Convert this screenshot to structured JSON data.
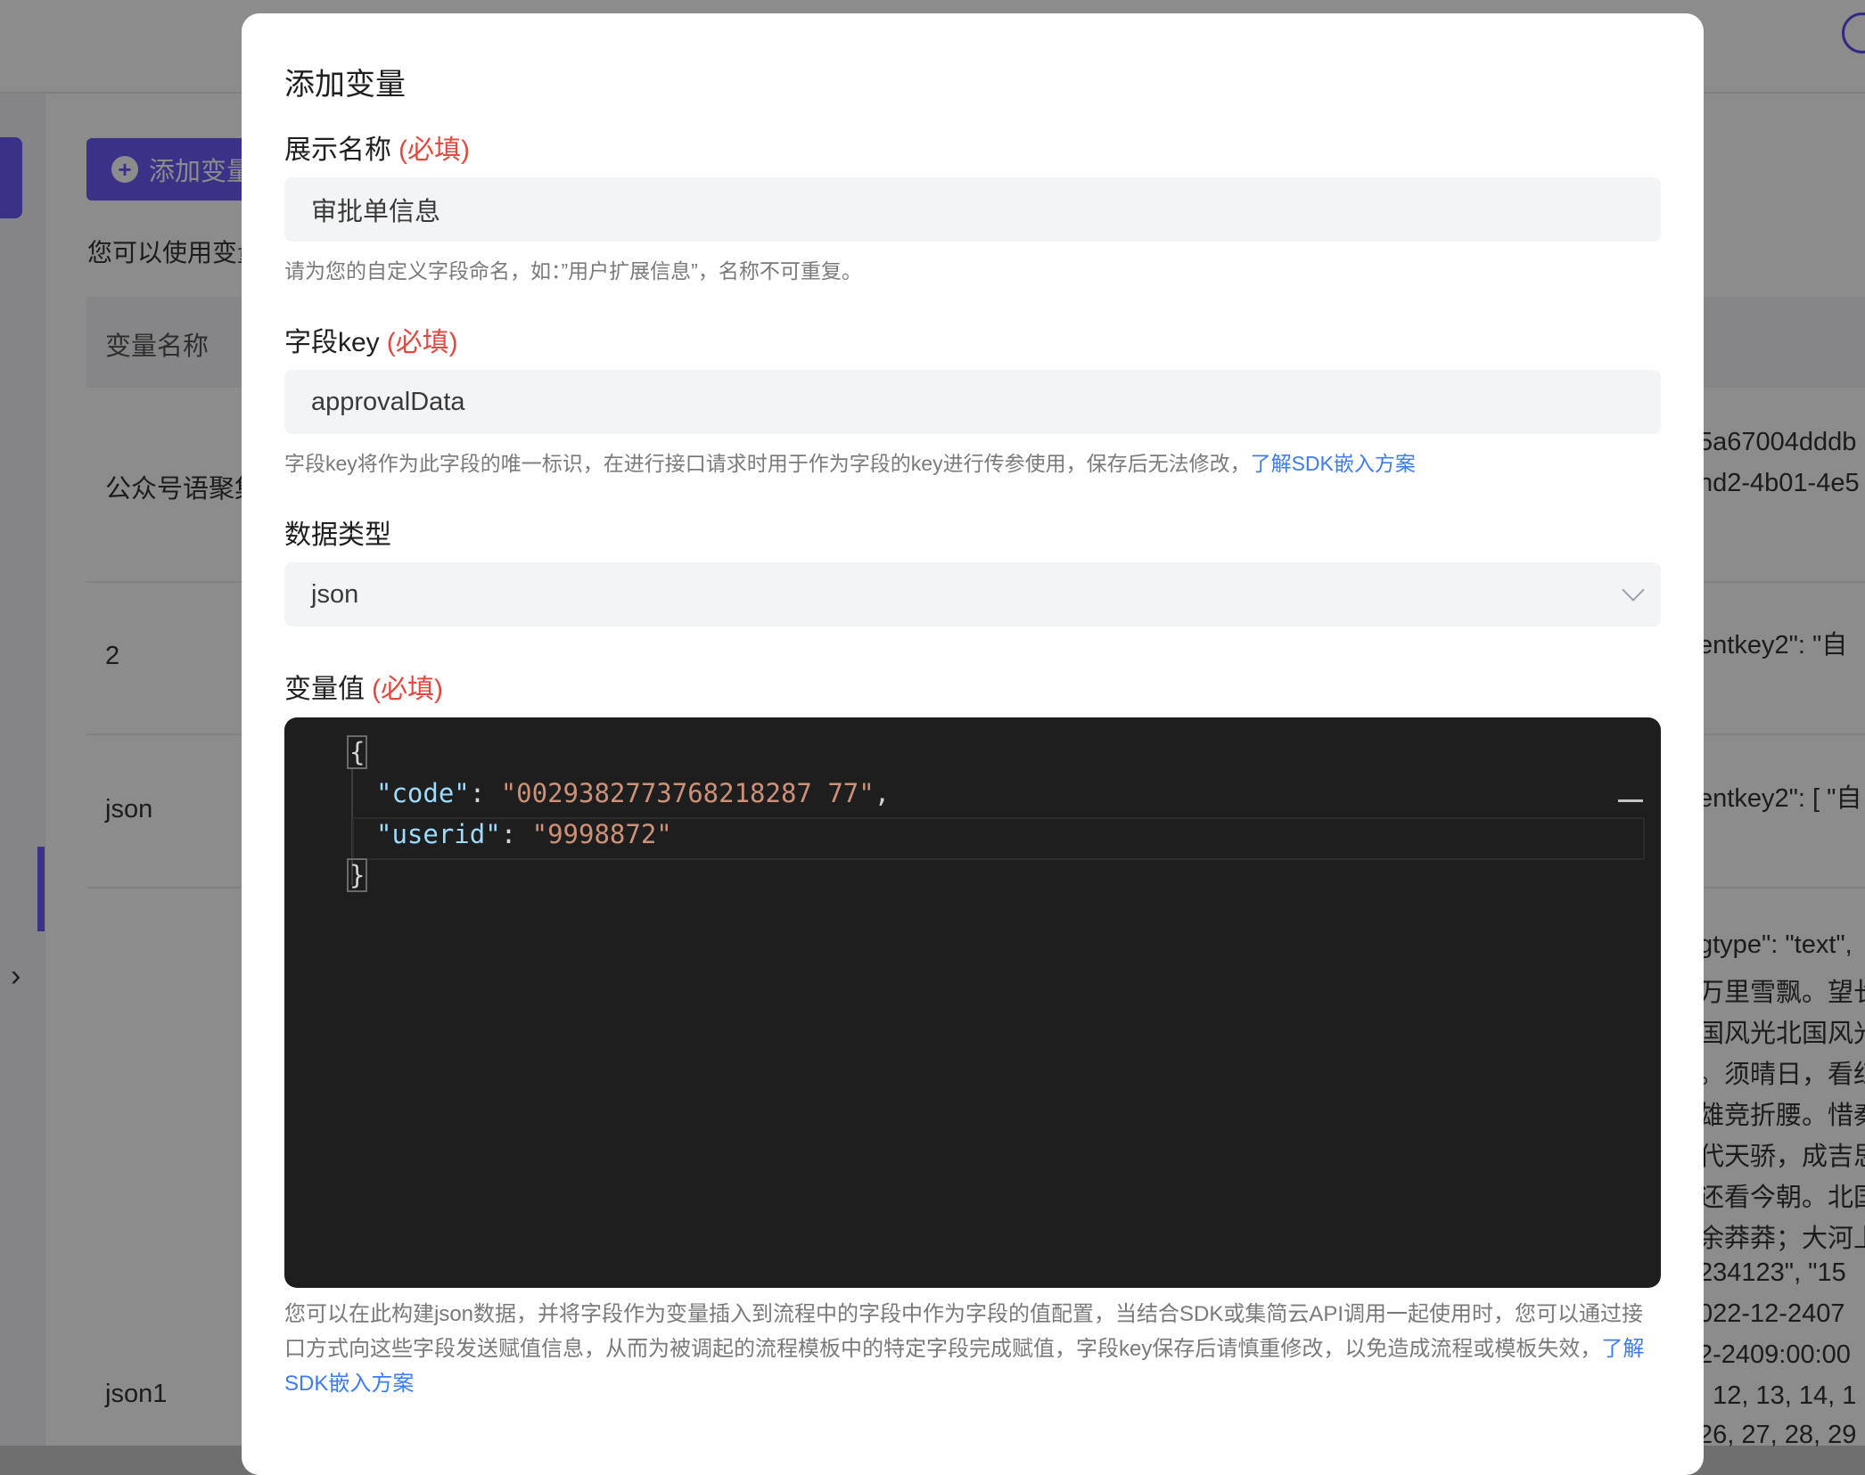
{
  "background": {
    "add_button_label": "添加变量",
    "hint_text": "您可以使用变量",
    "table_header": "变量名称",
    "rows": [
      {
        "name": "公众号语聚集"
      },
      {
        "name": "2"
      },
      {
        "name": "json"
      },
      {
        "name": "json1"
      }
    ],
    "right_column_fragments": [
      "5a67004dddb",
      "nd2-4b01-4e5",
      "entkey2\": \"自",
      "entkey2\": [ \"自",
      "gtype\": \"text\",",
      "万里雪飘。望长",
      "国风光北国风光",
      "。须晴日，看红",
      "雄竞折腰。惜秦",
      "代天骄，成吉思",
      "还看今朝。北国",
      "余莽莽；大河上",
      "234123\", \"15",
      "022-12-2407",
      "2-2409:00:00",
      ", 12, 13, 14, 1",
      "26, 27, 28, 29"
    ]
  },
  "modal": {
    "title": "添加变量",
    "required_mark": "(必填)",
    "display_name": {
      "label": "展示名称",
      "value": "审批单信息",
      "help": "请为您的自定义字段命名，如：”用户扩展信息”，名称不可重复。"
    },
    "field_key": {
      "label": "字段key",
      "value": "approvalData",
      "help": "字段key将作为此字段的唯一标识，在进行接口请求时用于作为字段的key进行传参使用，保存后无法修改，",
      "help_link": "了解SDK嵌入方案"
    },
    "data_type": {
      "label": "数据类型",
      "value": "json"
    },
    "variable_value": {
      "label": "变量值",
      "code": {
        "open_brace": "{",
        "close_brace": "}",
        "key1": "\"code\"",
        "val1": "\"0029382773768218287 77\"",
        "key2": "\"userid\"",
        "val2": "\"9998872\""
      },
      "description": "您可以在此构建json数据，并将字段作为变量插入到流程中的字段中作为字段的值配置，当结合SDK或集简云API调用一起使用时，您可以通过接口方式向这些字段发送赋值信息，从而为被调起的流程模板中的特定字段完成赋值，字段key保存后请慎重修改，以免造成流程或模板失效，",
      "description_link": "了解SDK嵌入方案"
    }
  }
}
